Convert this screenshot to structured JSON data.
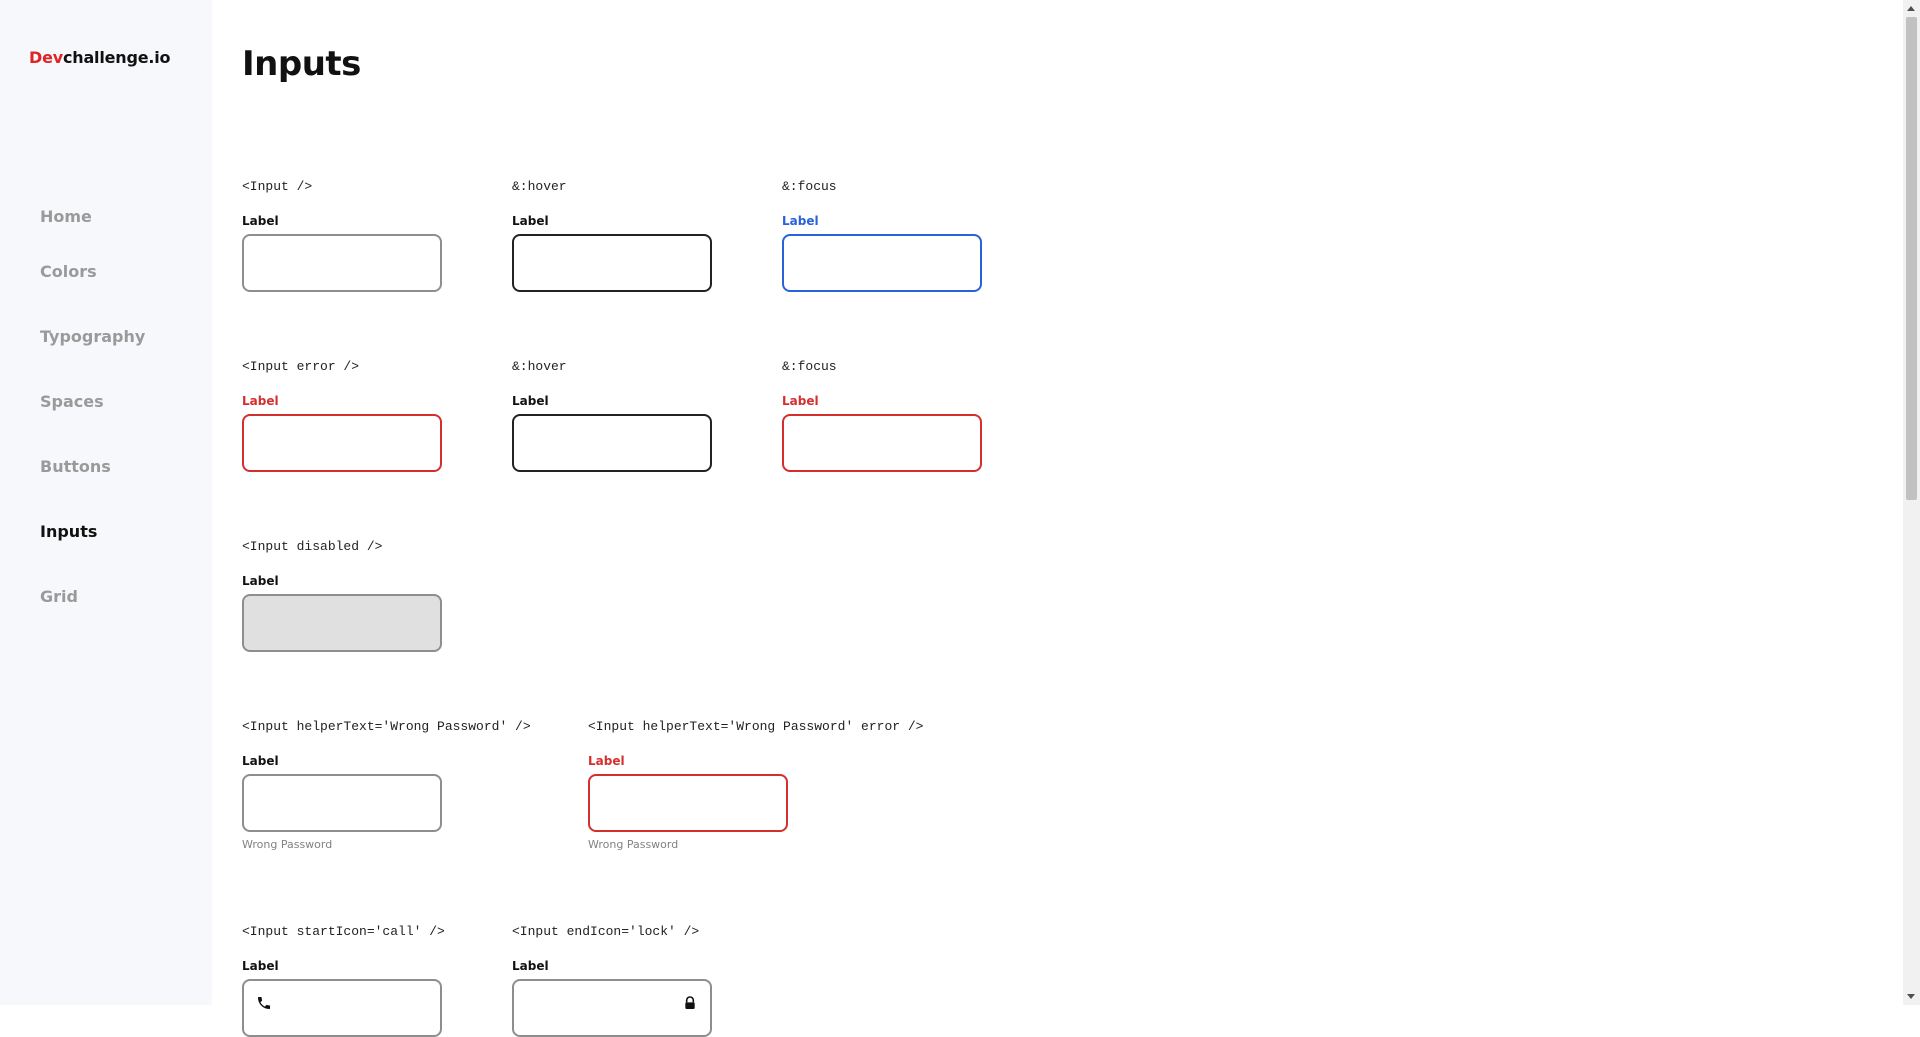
{
  "brand": {
    "accent": "Dev",
    "rest": "challenge.io"
  },
  "nav": {
    "items": [
      {
        "label": "Home"
      },
      {
        "label": "Colors"
      },
      {
        "label": "Typography"
      },
      {
        "label": "Spaces"
      },
      {
        "label": "Buttons"
      },
      {
        "label": "Inputs"
      },
      {
        "label": "Grid"
      }
    ],
    "active": "Inputs"
  },
  "page": {
    "title": "Inputs"
  },
  "demos": {
    "default": {
      "code": "<Input />",
      "label": "Label"
    },
    "hover": {
      "code": "&:hover",
      "label": "Label"
    },
    "focus": {
      "code": "&:focus",
      "label": "Label"
    },
    "error": {
      "code": "<Input error />",
      "label": "Label"
    },
    "error_hover": {
      "code": "&:hover",
      "label": "Label"
    },
    "error_focus": {
      "code": "&:focus",
      "label": "Label"
    },
    "disabled": {
      "code": "<Input disabled />",
      "label": "Label"
    },
    "helper": {
      "code": "<Input helperText='Wrong Password' />",
      "label": "Label",
      "helper": "Wrong Password"
    },
    "helper_error": {
      "code": "<Input helperText='Wrong Password' error />",
      "label": "Label",
      "helper": "Wrong Password"
    },
    "start_icon": {
      "code": "<Input startIcon='call' />",
      "label": "Label",
      "icon": "call-icon"
    },
    "end_icon": {
      "code": "<Input endIcon='lock' />",
      "label": "Label",
      "icon": "lock-icon"
    }
  },
  "colors": {
    "brand_red": "#e02424",
    "focus_blue": "#2962d9",
    "error_red": "#d32f2f",
    "disabled_bg": "#e0e0e0",
    "sidebar_bg": "#f7f8fb"
  }
}
